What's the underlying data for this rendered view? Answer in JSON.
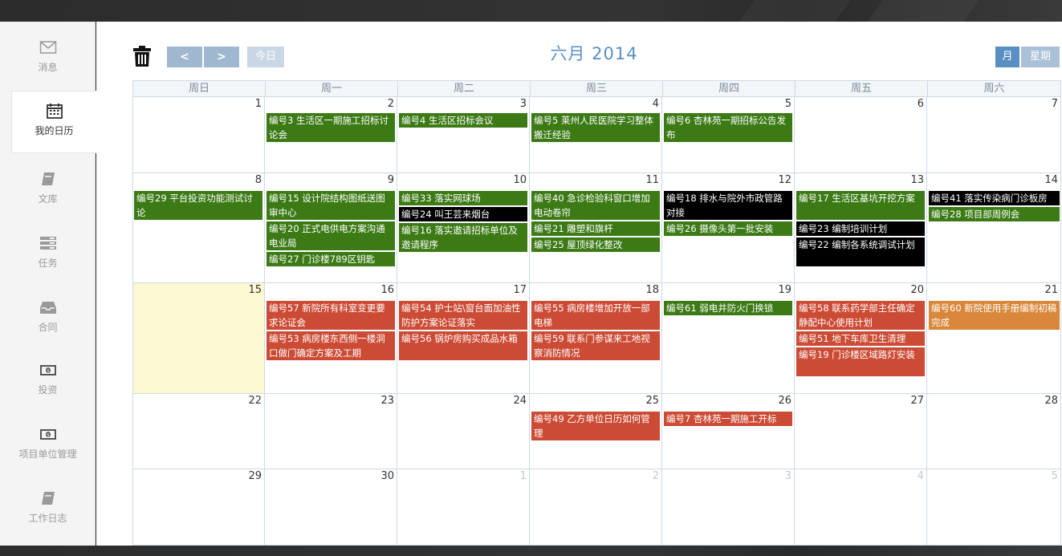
{
  "sidebar": {
    "items": [
      {
        "label": "消息",
        "icon": "mail-icon"
      },
      {
        "label": "我的日历",
        "icon": "calendar-icon"
      },
      {
        "label": "文库",
        "icon": "book-icon"
      },
      {
        "label": "任务",
        "icon": "tasks-icon"
      },
      {
        "label": "合同",
        "icon": "inbox-icon"
      },
      {
        "label": "投资",
        "icon": "money-icon"
      },
      {
        "label": "项目单位管理",
        "icon": "money-icon"
      },
      {
        "label": "工作日志",
        "icon": "book-icon"
      }
    ]
  },
  "toolbar": {
    "prev": "<",
    "next": ">",
    "today": "今日",
    "title": "六月 2014",
    "month_view": "月",
    "week_view": "星期"
  },
  "calendar": {
    "weekdays": [
      "周日",
      "周一",
      "周二",
      "周三",
      "周四",
      "周五",
      "周六"
    ],
    "weeks": [
      [
        "1",
        "2",
        "3",
        "4",
        "5",
        "6",
        "7"
      ],
      [
        "8",
        "9",
        "10",
        "11",
        "12",
        "13",
        "14"
      ],
      [
        "15",
        "16",
        "17",
        "18",
        "19",
        "20",
        "21"
      ],
      [
        "22",
        "23",
        "24",
        "25",
        "26",
        "27",
        "28"
      ],
      [
        "29",
        "30",
        "1",
        "2",
        "3",
        "4",
        "5"
      ]
    ],
    "events": {
      "w0": [
        {
          "text": "编号3 生活区一期施工招标讨论会",
          "color": "green"
        },
        {
          "text": "编号4 生活区招标会议",
          "color": "green"
        },
        {
          "text": "编号5 莱州人民医院学习整体搬迁经验",
          "color": "green"
        },
        {
          "text": "编号6 杏林苑一期招标公告发布",
          "color": "green"
        }
      ],
      "w1": [
        {
          "text": "编号29 平台投资功能测试讨论",
          "color": "green"
        },
        {
          "text": "编号15 设计院结构图纸送图审中心",
          "color": "green"
        },
        {
          "text": "编号20 正式电供电方案沟通电业局",
          "color": "green"
        },
        {
          "text": "编号27 门诊楼789区钥匙",
          "color": "green"
        },
        {
          "text": "编号33 落实网球场",
          "color": "green"
        },
        {
          "text": "编号24 叫王芸来烟台",
          "color": "black"
        },
        {
          "text": "编号16 落实邀请招标单位及邀请程序",
          "color": "green"
        },
        {
          "text": "编号40 急诊检验科窗口增加电动卷帘",
          "color": "green"
        },
        {
          "text": "编号21 雕塑和旗杆",
          "color": "green"
        },
        {
          "text": "编号25 屋顶绿化整改",
          "color": "green"
        },
        {
          "text": "编号18 排水与院外市政管路对接",
          "color": "black"
        },
        {
          "text": "编号26 摄像头第一批安装",
          "color": "green"
        },
        {
          "text": "编号17 生活区基坑开挖方案",
          "color": "green"
        },
        {
          "text": "编号23 编制培训计划",
          "color": "black"
        },
        {
          "text": "编号22 编制各系统调试计划",
          "color": "black"
        },
        {
          "text": "编号41 落实传染病门诊板房",
          "color": "black"
        },
        {
          "text": "编号28 项目部周例会",
          "color": "green"
        }
      ],
      "w2": [
        {
          "text": "编号57 新院所有科室变更要求论证会",
          "color": "red"
        },
        {
          "text": "编号53 病房楼东西侧一楼洞口做门确定方案及工期",
          "color": "red"
        },
        {
          "text": "编号54 护士站\\窗台面加油性防护方案论证落实",
          "color": "red"
        },
        {
          "text": "编号56 锅炉房购买成品水箱",
          "color": "red"
        },
        {
          "text": "编号55 病房楼增加开放一部电梯",
          "color": "red"
        },
        {
          "text": "编号59 联系门参谋来工地视察消防情况",
          "color": "red"
        },
        {
          "text": "编号61 弱电井防火门换锁",
          "color": "green"
        },
        {
          "text": "编号58 联系药学部主任确定静配中心使用计划",
          "color": "red"
        },
        {
          "text": "编号51 地下车库卫生清理",
          "color": "red"
        },
        {
          "text": "编号19 门诊楼区域路灯安装",
          "color": "red"
        },
        {
          "text": "编号60 新院使用手册编制初稿完成",
          "color": "orange"
        }
      ],
      "w3": [
        {
          "text": "编号49 乙方单位日历如何管理",
          "color": "red"
        },
        {
          "text": "编号7 杏林苑一期施工开标",
          "color": "red"
        }
      ]
    }
  }
}
